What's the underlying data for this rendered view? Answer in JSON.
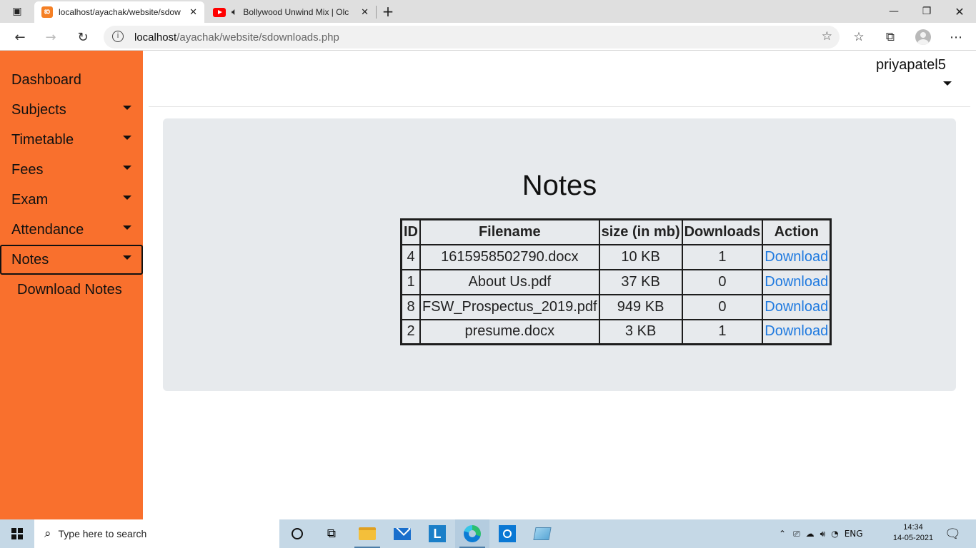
{
  "browser": {
    "tabs": [
      {
        "title": "localhost/ayachak/website/sdow",
        "favicon": "xampp-icon",
        "active": true
      },
      {
        "title": "Bollywood Unwind Mix | Olc",
        "favicon": "youtube-icon",
        "active": false,
        "audio": "speaker-icon"
      }
    ],
    "address": {
      "host": "localhost",
      "path": "/ayachak/website/sdownloads.php"
    }
  },
  "sidebar": {
    "items": [
      {
        "label": "Dashboard",
        "has_caret": false
      },
      {
        "label": "Subjects",
        "has_caret": true
      },
      {
        "label": "Timetable",
        "has_caret": true
      },
      {
        "label": "Fees",
        "has_caret": true
      },
      {
        "label": "Exam",
        "has_caret": true
      },
      {
        "label": "Attendance",
        "has_caret": true
      },
      {
        "label": "Notes",
        "has_caret": true,
        "active": true
      }
    ],
    "subitems": [
      {
        "label": "Download Notes"
      }
    ],
    "color": "#f9702d"
  },
  "header": {
    "username": "priyapatel5"
  },
  "main": {
    "title": "Notes",
    "table": {
      "headers": [
        "ID",
        "Filename",
        "size (in mb)",
        "Downloads",
        "Action"
      ],
      "rows": [
        {
          "id": "4",
          "filename": "1615958502790.docx",
          "size": "10 KB",
          "downloads": "1",
          "action": "Download"
        },
        {
          "id": "1",
          "filename": "About Us.pdf",
          "size": "37 KB",
          "downloads": "0",
          "action": "Download"
        },
        {
          "id": "8",
          "filename": "FSW_Prospectus_2019.pdf",
          "size": "949 KB",
          "downloads": "0",
          "action": "Download"
        },
        {
          "id": "2",
          "filename": "presume.docx",
          "size": "3 KB",
          "downloads": "1",
          "action": "Download"
        }
      ]
    },
    "link_color": "#1f7ae0"
  },
  "taskbar": {
    "search_placeholder": "Type here to search",
    "language": "ENG",
    "time": "14:34",
    "date": "14-05-2021"
  }
}
